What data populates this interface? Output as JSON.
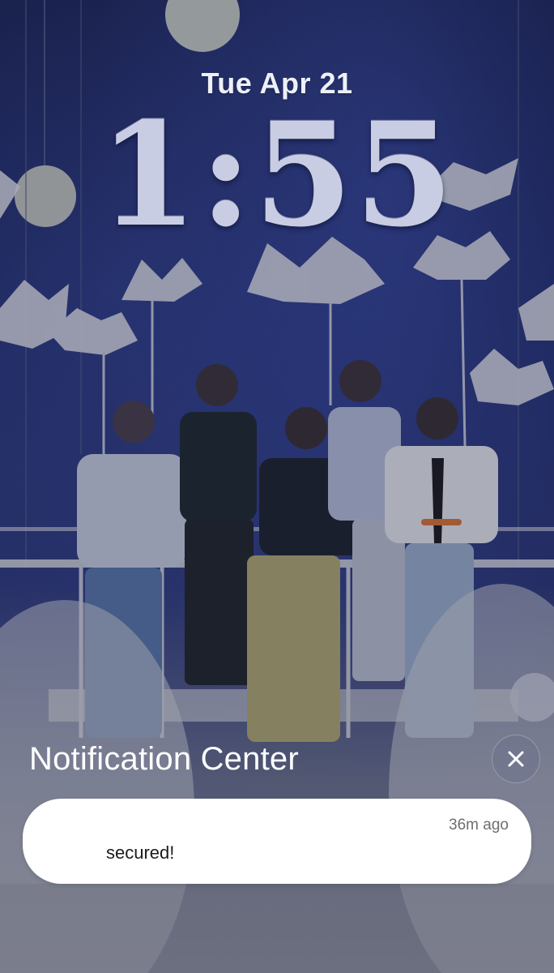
{
  "lockscreen": {
    "date": "Tue Apr 21",
    "time": "1:55"
  },
  "notification_center": {
    "title": "Notification Center",
    "close_icon": "close-icon"
  },
  "notifications": [
    {
      "message": "secured!",
      "time_ago": "36m ago"
    }
  ],
  "colors": {
    "wallpaper_top": "#141c4a",
    "wallpaper_mid": "#2a3577",
    "notification_bg": "#ffffff"
  }
}
